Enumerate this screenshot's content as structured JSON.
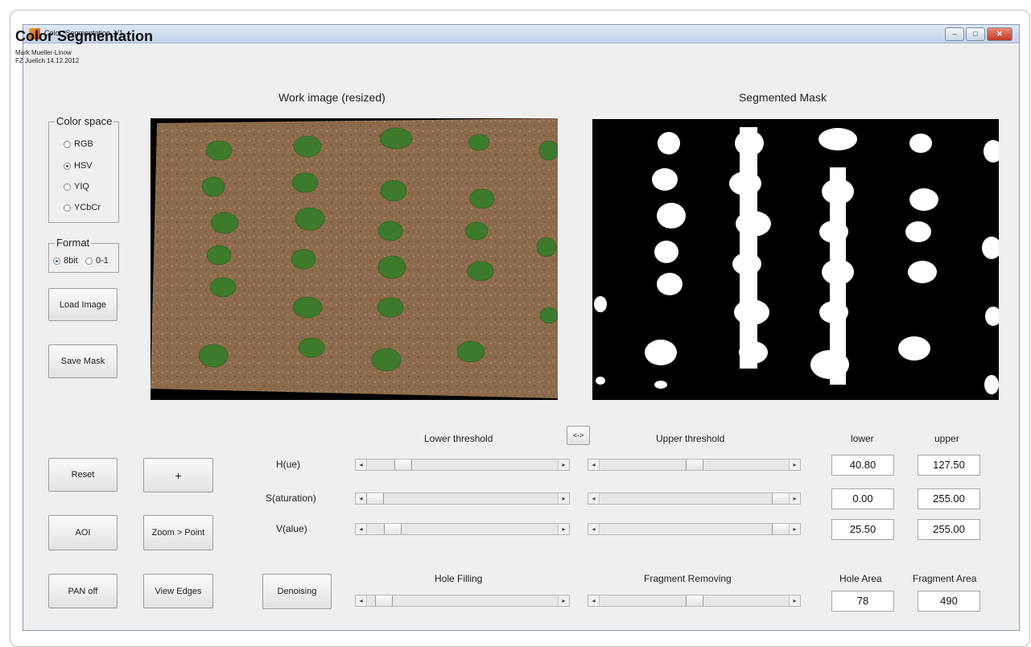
{
  "window": {
    "title": "Color_Segmentation_V1"
  },
  "app": {
    "title": "Color Segmentation",
    "author_line1": "Mark Mueller-Linow",
    "author_line2": "FZ Juelich 14.12.2012"
  },
  "panels": {
    "work_image_title": "Work image (resized)",
    "mask_title": "Segmented Mask"
  },
  "color_space": {
    "legend": "Color space",
    "options": [
      {
        "label": "RGB",
        "selected": false
      },
      {
        "label": "HSV",
        "selected": true
      },
      {
        "label": "YIQ",
        "selected": false
      },
      {
        "label": "YCbCr",
        "selected": false
      }
    ]
  },
  "format": {
    "legend": "Format",
    "options": [
      {
        "label": "8bit",
        "selected": true
      },
      {
        "label": "0-1",
        "selected": false
      }
    ]
  },
  "buttons": {
    "load_image": "Load Image",
    "save_mask": "Save Mask",
    "reset": "Reset",
    "plus": "+",
    "aoi": "AOI",
    "zoom_point": "Zoom > Point",
    "pan_off": "PAN off",
    "view_edges": "View Edges",
    "denoising": "Denoising",
    "swap": "<->"
  },
  "thresholds": {
    "lower_header": "Lower threshold",
    "upper_header": "Upper threshold",
    "lower_col": "lower",
    "upper_col": "upper",
    "rows": [
      {
        "label": "H(ue)",
        "lower_value": "40.80",
        "upper_value": "127.50",
        "lower_fraction": 0.16,
        "upper_fraction": 0.5
      },
      {
        "label": "S(aturation)",
        "lower_value": "0.00",
        "upper_value": "255.00",
        "lower_fraction": 0.0,
        "upper_fraction": 1.0
      },
      {
        "label": "V(alue)",
        "lower_value": "25.50",
        "upper_value": "255.00",
        "lower_fraction": 0.1,
        "upper_fraction": 1.0
      }
    ]
  },
  "post": {
    "hole_filling": "Hole Filling",
    "fragment_removing": "Fragment Removing",
    "hole_area_label": "Hole Area",
    "fragment_area_label": "Fragment Area",
    "hole_area_value": "78",
    "fragment_area_value": "490",
    "hole_fraction": 0.05,
    "fragment_fraction": 0.5
  },
  "colors": {
    "soil": "#8a6a4a",
    "plant": "#3f7a2a",
    "mask_bg": "#000000",
    "mask_fg": "#ffffff"
  }
}
